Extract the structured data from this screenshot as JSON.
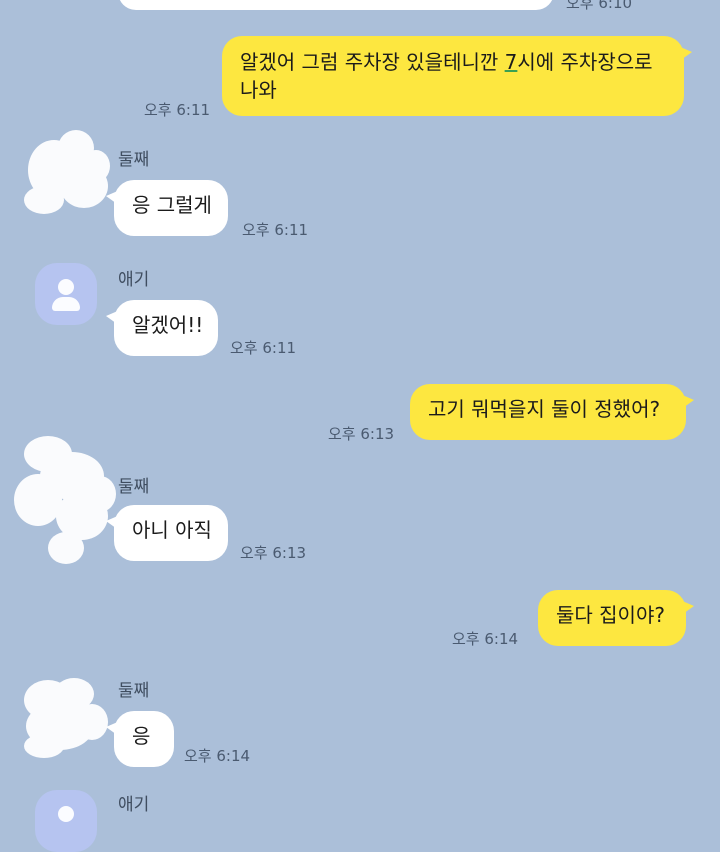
{
  "messages": {
    "m0_time": "오후 6:10",
    "m1": {
      "line1_before": "알겠어 그럼 주차장 있을테니깐 ",
      "line1_link": "7",
      "line1_after": "시에 주차장으로",
      "line2": "나와",
      "time": "오후 6:11"
    },
    "m2": {
      "sender": "둘째",
      "text": "응 그럴게",
      "time": "오후 6:11"
    },
    "m3": {
      "sender": "애기",
      "text": "알겠어!!",
      "time": "오후 6:11"
    },
    "m4": {
      "text": "고기 뭐먹을지 둘이 정했어?",
      "time": "오후 6:13"
    },
    "m5": {
      "sender": "둘째",
      "text": "아니 아직",
      "time": "오후 6:13"
    },
    "m6": {
      "text": "둘다 집이야?",
      "time": "오후 6:14"
    },
    "m7": {
      "sender": "둘째",
      "text": "응",
      "time": "오후 6:14"
    },
    "m8": {
      "sender": "애기"
    }
  },
  "colors": {
    "background": "#abbfd9",
    "my_bubble": "#fde740",
    "other_bubble": "#ffffff",
    "default_avatar": "#b6c4f0"
  }
}
